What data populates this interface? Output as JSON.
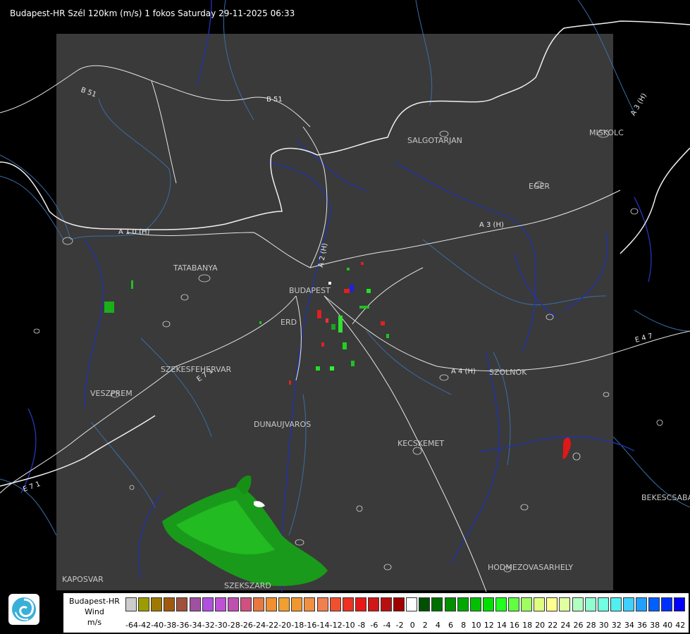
{
  "title": "Budapest-HR Szél 120km (m/s) 1 fokos Saturday 29-11-2025 06:33",
  "cities": [
    {
      "name": "SALGOTARJAN"
    },
    {
      "name": "MISKOLC"
    },
    {
      "name": "EGER"
    },
    {
      "name": "TATABANYA"
    },
    {
      "name": "BUDAPEST"
    },
    {
      "name": "ERD"
    },
    {
      "name": "SZEKESFEHERVAR"
    },
    {
      "name": "VESZPREM"
    },
    {
      "name": "DUNAUJVAROS"
    },
    {
      "name": "KECSKEMET"
    },
    {
      "name": "SZOLNOK"
    },
    {
      "name": "BEKESCSABA"
    },
    {
      "name": "KAPOSVAR"
    },
    {
      "name": "SZEKSZARD"
    },
    {
      "name": "HODMEZOVASARHELY"
    }
  ],
  "roads": [
    {
      "name": "B 51"
    },
    {
      "name": "B 51"
    },
    {
      "name": "A 3 (H)"
    },
    {
      "name": "A 3 (H)"
    },
    {
      "name": "A 4 (H)"
    },
    {
      "name": "A 1 0 (H)"
    },
    {
      "name": "A 2 (H)"
    },
    {
      "name": "E 4 7"
    },
    {
      "name": "E 7 1"
    },
    {
      "name": "E 7 1"
    }
  ],
  "legend": {
    "line1": "Budapest-HR",
    "line2": "Wind",
    "line3": "m/s",
    "labels": [
      "-64",
      "-42",
      "-40",
      "-38",
      "-36",
      "-34",
      "-32",
      "-30",
      "-28",
      "-26",
      "-24",
      "-22",
      "-20",
      "-18",
      "-16",
      "-14",
      "-12",
      "-10",
      "-8",
      "-6",
      "-4",
      "-2",
      "0",
      "2",
      "4",
      "6",
      "8",
      "10",
      "12",
      "14",
      "16",
      "18",
      "20",
      "22",
      "24",
      "26",
      "28",
      "30",
      "32",
      "34",
      "36",
      "38",
      "40",
      "42"
    ],
    "colors": [
      "#cccccc",
      "#9c9c00",
      "#a07800",
      "#a05a10",
      "#a0503c",
      "#a050a0",
      "#b050e0",
      "#c050d8",
      "#c050b0",
      "#d05080",
      "#e87840",
      "#f09030",
      "#f0a030",
      "#f09830",
      "#f09040",
      "#f08050",
      "#f05030",
      "#f03020",
      "#e81818",
      "#d01818",
      "#b81010",
      "#a00000",
      "#ffffff",
      "#005000",
      "#007000",
      "#009000",
      "#00a800",
      "#00c000",
      "#00e000",
      "#20ff20",
      "#60ff40",
      "#a0ff60",
      "#e0ff80",
      "#ffff90",
      "#e0ffa0",
      "#b0ffc0",
      "#90ffd0",
      "#70ffe0",
      "#50f0f0",
      "#40d0ff",
      "#20a0ff",
      "#0060ff",
      "#0030ff",
      "#0000ff"
    ]
  }
}
